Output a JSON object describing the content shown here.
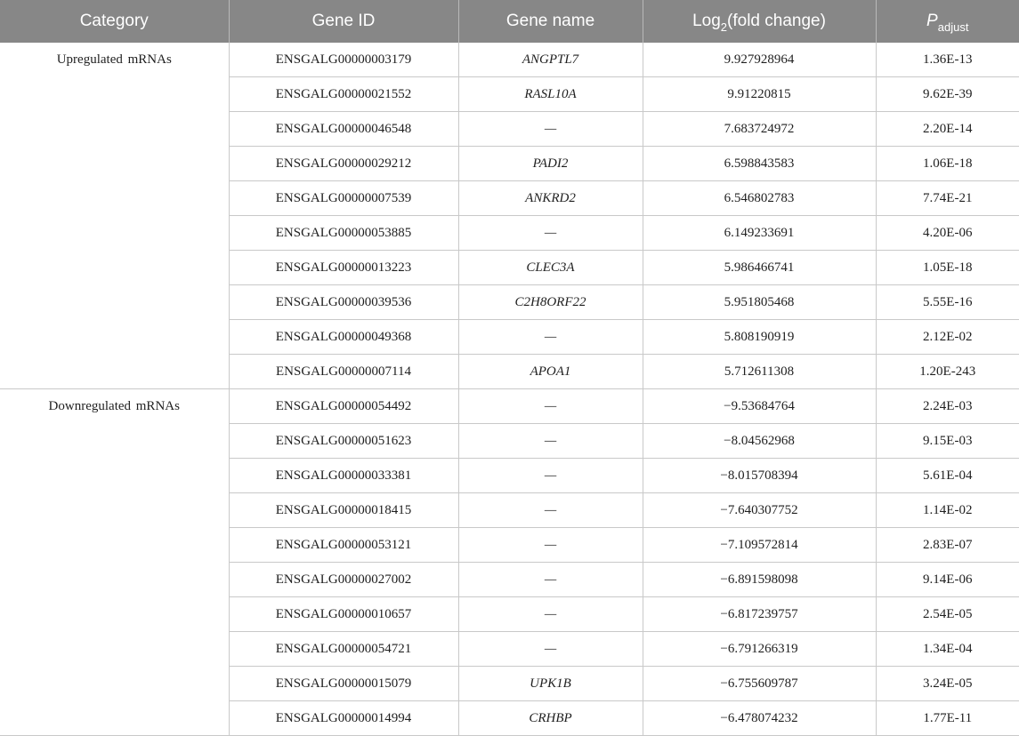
{
  "table": {
    "headers": {
      "category": "Category",
      "gene_id": "Gene ID",
      "gene_name": "Gene name",
      "log2fc_prefix": "Log",
      "log2fc_sub": "2",
      "log2fc_suffix": "(fold change)",
      "padj_symbol": "P",
      "padj_sub": "adjust"
    },
    "groups": [
      {
        "category": "Upregulated mRNAs",
        "rows": [
          {
            "gene_id": "ENSGALG00000003179",
            "gene_name": "ANGPTL7",
            "log2fc": "9.927928964",
            "padj": "1.36E-13"
          },
          {
            "gene_id": "ENSGALG00000021552",
            "gene_name": "RASL10A",
            "log2fc": "9.91220815",
            "padj": "9.62E-39"
          },
          {
            "gene_id": "ENSGALG00000046548",
            "gene_name": "—",
            "log2fc": "7.683724972",
            "padj": "2.20E-14"
          },
          {
            "gene_id": "ENSGALG00000029212",
            "gene_name": "PADI2",
            "log2fc": "6.598843583",
            "padj": "1.06E-18"
          },
          {
            "gene_id": "ENSGALG00000007539",
            "gene_name": "ANKRD2",
            "log2fc": "6.546802783",
            "padj": "7.74E-21"
          },
          {
            "gene_id": "ENSGALG00000053885",
            "gene_name": "—",
            "log2fc": "6.149233691",
            "padj": "4.20E-06"
          },
          {
            "gene_id": "ENSGALG00000013223",
            "gene_name": "CLEC3A",
            "log2fc": "5.986466741",
            "padj": "1.05E-18"
          },
          {
            "gene_id": "ENSGALG00000039536",
            "gene_name": "C2H8ORF22",
            "log2fc": "5.951805468",
            "padj": "5.55E-16"
          },
          {
            "gene_id": "ENSGALG00000049368",
            "gene_name": "—",
            "log2fc": "5.808190919",
            "padj": "2.12E-02"
          },
          {
            "gene_id": "ENSGALG00000007114",
            "gene_name": "APOA1",
            "log2fc": "5.712611308",
            "padj": "1.20E-243"
          }
        ]
      },
      {
        "category": "Downregulated mRNAs",
        "rows": [
          {
            "gene_id": "ENSGALG00000054492",
            "gene_name": "—",
            "log2fc": "−9.53684764",
            "padj": "2.24E-03"
          },
          {
            "gene_id": "ENSGALG00000051623",
            "gene_name": "—",
            "log2fc": "−8.04562968",
            "padj": "9.15E-03"
          },
          {
            "gene_id": "ENSGALG00000033381",
            "gene_name": "—",
            "log2fc": "−8.015708394",
            "padj": "5.61E-04"
          },
          {
            "gene_id": "ENSGALG00000018415",
            "gene_name": "—",
            "log2fc": "−7.640307752",
            "padj": "1.14E-02"
          },
          {
            "gene_id": "ENSGALG00000053121",
            "gene_name": "—",
            "log2fc": "−7.109572814",
            "padj": "2.83E-07"
          },
          {
            "gene_id": "ENSGALG00000027002",
            "gene_name": "—",
            "log2fc": "−6.891598098",
            "padj": "9.14E-06"
          },
          {
            "gene_id": "ENSGALG00000010657",
            "gene_name": "—",
            "log2fc": "−6.817239757",
            "padj": "2.54E-05"
          },
          {
            "gene_id": "ENSGALG00000054721",
            "gene_name": "—",
            "log2fc": "−6.791266319",
            "padj": "1.34E-04"
          },
          {
            "gene_id": "ENSGALG00000015079",
            "gene_name": "UPK1B",
            "log2fc": "−6.755609787",
            "padj": "3.24E-05"
          },
          {
            "gene_id": "ENSGALG00000014994",
            "gene_name": "CRHBP",
            "log2fc": "−6.478074232",
            "padj": "1.77E-11"
          }
        ]
      }
    ]
  }
}
